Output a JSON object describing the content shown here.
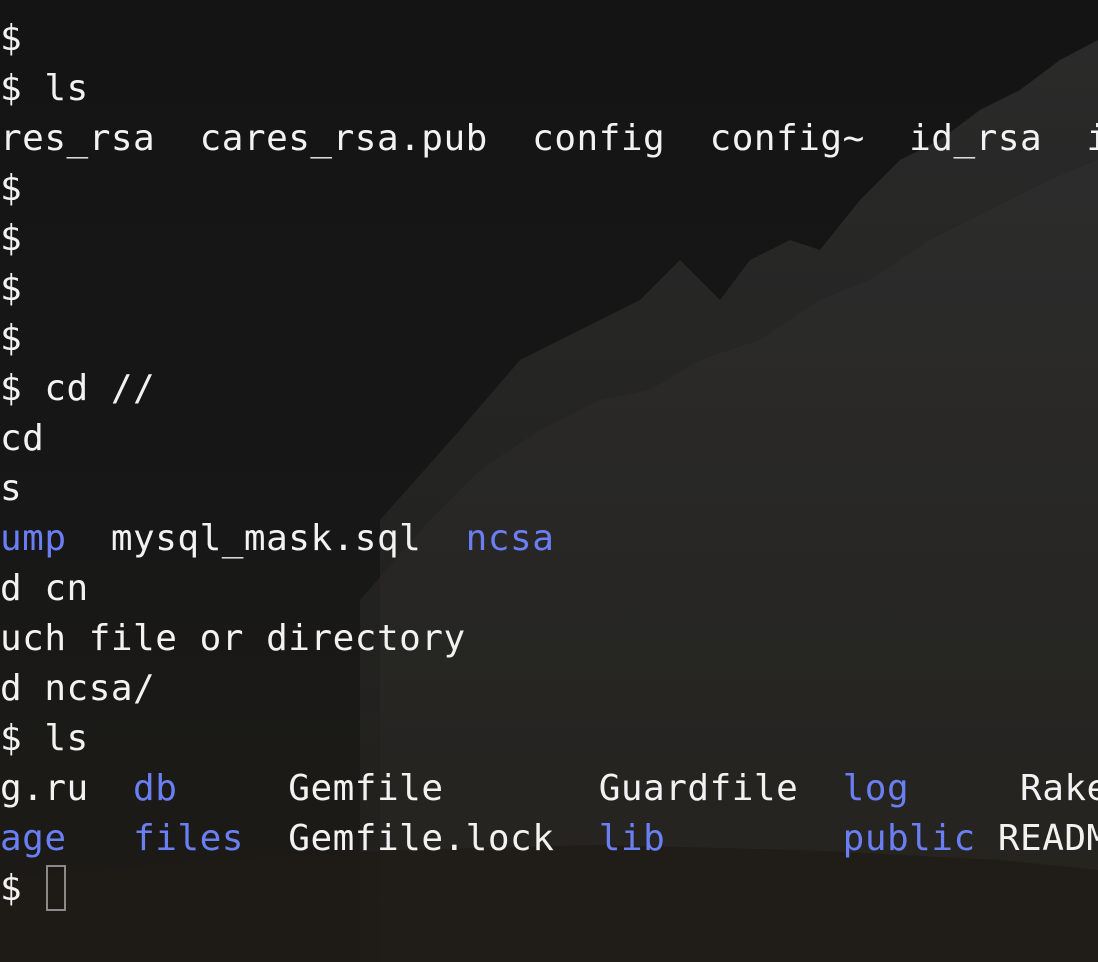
{
  "terminal": {
    "colors": {
      "background": "#151515",
      "text": "#f2f2f2",
      "directory": "#6b7ff5",
      "cursor_outline": "#8a8a8a"
    },
    "lines": [
      {
        "segments": [
          {
            "text": "$",
            "kind": "text"
          }
        ]
      },
      {
        "segments": [
          {
            "text": "$ ls",
            "kind": "text"
          }
        ]
      },
      {
        "segments": [
          {
            "text": "res_rsa  cares_rsa.pub  config  config~  id_rsa  id",
            "kind": "text"
          }
        ]
      },
      {
        "segments": [
          {
            "text": "$",
            "kind": "text"
          }
        ]
      },
      {
        "segments": [
          {
            "text": "$",
            "kind": "text"
          }
        ]
      },
      {
        "segments": [
          {
            "text": "$",
            "kind": "text"
          }
        ]
      },
      {
        "segments": [
          {
            "text": "$",
            "kind": "text"
          }
        ]
      },
      {
        "segments": [
          {
            "text": "$ cd //",
            "kind": "text"
          }
        ]
      },
      {
        "segments": [
          {
            "text": "cd",
            "kind": "text"
          }
        ]
      },
      {
        "segments": [
          {
            "text": "s",
            "kind": "text"
          }
        ]
      },
      {
        "segments": [
          {
            "text": "ump",
            "kind": "dir"
          },
          {
            "text": "  mysql_mask.sql  ",
            "kind": "text"
          },
          {
            "text": "ncsa",
            "kind": "dir"
          }
        ]
      },
      {
        "segments": [
          {
            "text": "d cn",
            "kind": "text"
          }
        ]
      },
      {
        "segments": [
          {
            "text": "uch file or directory",
            "kind": "text"
          }
        ]
      },
      {
        "segments": [
          {
            "text": "d ncsa/",
            "kind": "text"
          }
        ]
      },
      {
        "segments": [
          {
            "text": "$ ls",
            "kind": "text"
          }
        ]
      },
      {
        "segments": [
          {
            "text": "g.ru  ",
            "kind": "text"
          },
          {
            "text": "db",
            "kind": "dir"
          },
          {
            "text": "     Gemfile       Guardfile  ",
            "kind": "text"
          },
          {
            "text": "log",
            "kind": "dir"
          },
          {
            "text": "     Rakefile",
            "kind": "text"
          }
        ]
      },
      {
        "segments": [
          {
            "text": "age",
            "kind": "dir"
          },
          {
            "text": "   ",
            "kind": "text"
          },
          {
            "text": "files",
            "kind": "dir"
          },
          {
            "text": "  Gemfile.lock  ",
            "kind": "text"
          },
          {
            "text": "lib",
            "kind": "dir"
          },
          {
            "text": "        ",
            "kind": "text"
          },
          {
            "text": "public",
            "kind": "dir"
          },
          {
            "text": " README",
            "kind": "text"
          }
        ]
      },
      {
        "segments": [
          {
            "text": "$ ",
            "kind": "text"
          }
        ],
        "cursor": true
      }
    ]
  }
}
